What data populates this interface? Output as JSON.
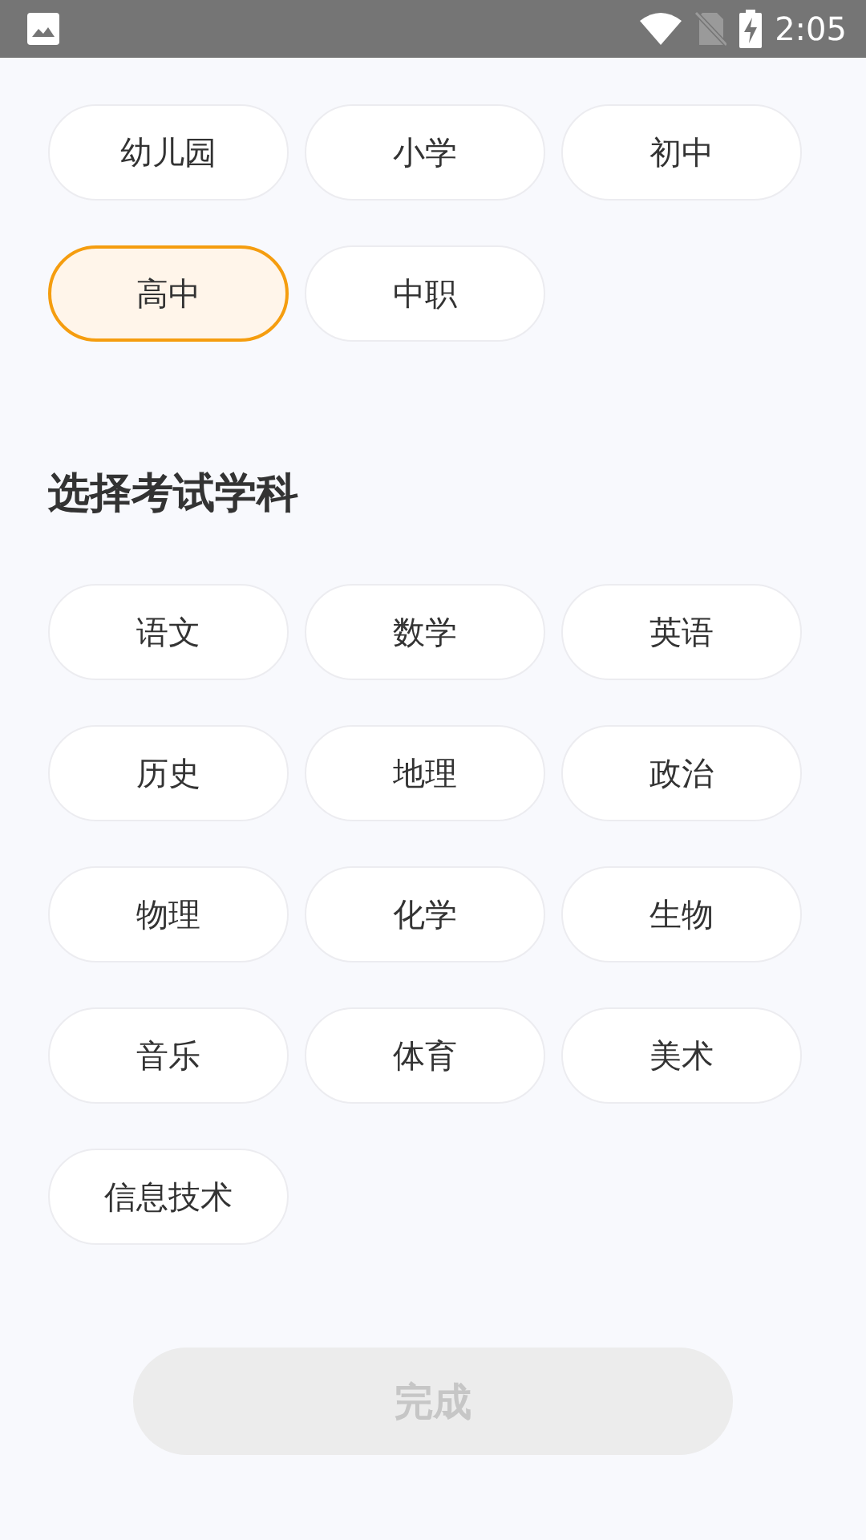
{
  "status_bar": {
    "time": "2:05"
  },
  "grades": [
    {
      "label": "幼儿园",
      "selected": false
    },
    {
      "label": "小学",
      "selected": false
    },
    {
      "label": "初中",
      "selected": false
    },
    {
      "label": "高中",
      "selected": true
    },
    {
      "label": "中职",
      "selected": false
    }
  ],
  "subjects_title": "选择考试学科",
  "subjects": [
    {
      "label": "语文",
      "selected": false
    },
    {
      "label": "数学",
      "selected": false
    },
    {
      "label": "英语",
      "selected": false
    },
    {
      "label": "历史",
      "selected": false
    },
    {
      "label": "地理",
      "selected": false
    },
    {
      "label": "政治",
      "selected": false
    },
    {
      "label": "物理",
      "selected": false
    },
    {
      "label": "化学",
      "selected": false
    },
    {
      "label": "生物",
      "selected": false
    },
    {
      "label": "音乐",
      "selected": false
    },
    {
      "label": "体育",
      "selected": false
    },
    {
      "label": "美术",
      "selected": false
    },
    {
      "label": "信息技术",
      "selected": false
    }
  ],
  "done_button": {
    "label": "完成",
    "disabled": true
  }
}
